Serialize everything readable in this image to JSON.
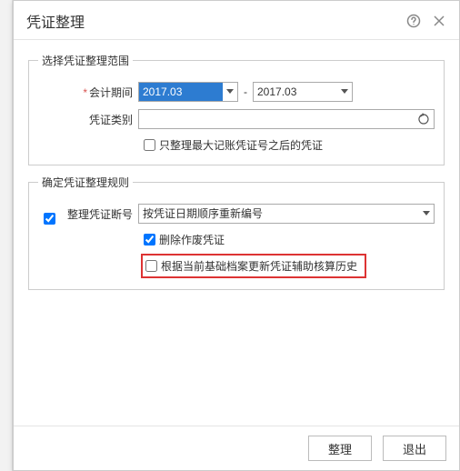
{
  "dialog": {
    "title": "凭证整理"
  },
  "range": {
    "legend": "选择凭证整理范围",
    "period_label": "会计期间",
    "period_from": "2017.03",
    "period_to": "2017.03",
    "category_label": "凭证类别",
    "category_value": "",
    "only_after_max_label": "只整理最大记账凭证号之后的凭证",
    "only_after_max_checked": false
  },
  "rules": {
    "legend": "确定凭证整理规则",
    "enable_checked": true,
    "renumber_label": "整理凭证断号",
    "renumber_option": "按凭证日期顺序重新编号",
    "delete_void_label": "删除作废凭证",
    "delete_void_checked": true,
    "update_aux_label": "根据当前基础档案更新凭证辅助核算历史",
    "update_aux_checked": false
  },
  "footer": {
    "organize": "整理",
    "exit": "退出"
  }
}
